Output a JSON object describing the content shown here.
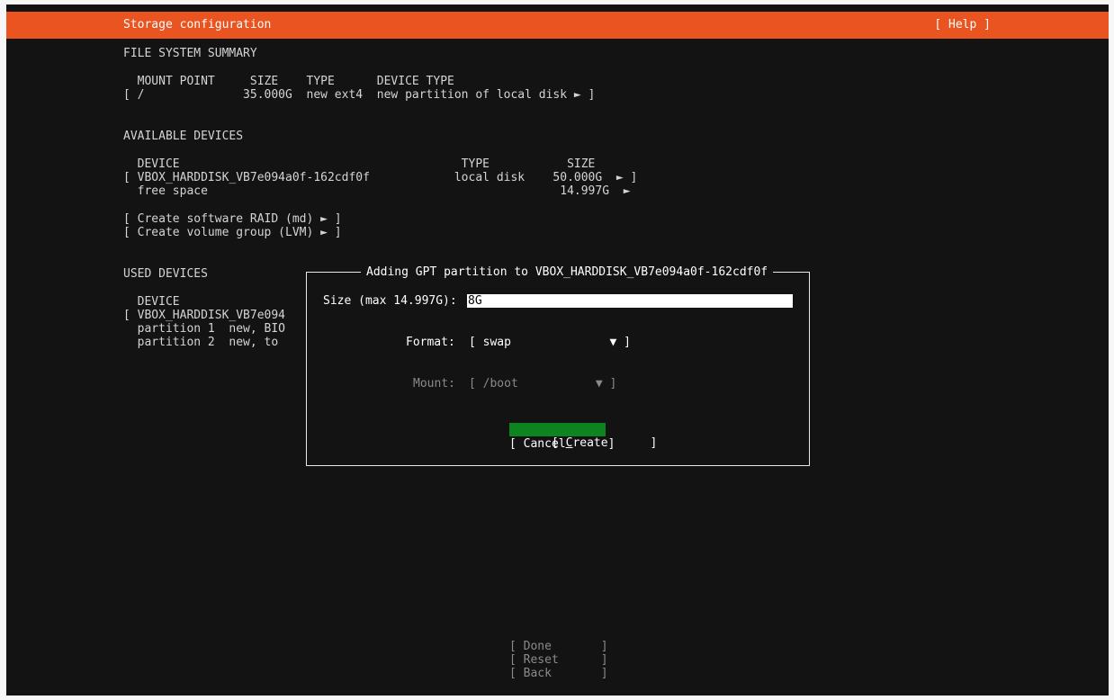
{
  "header": {
    "title": "Storage configuration",
    "help": "[ Help ]"
  },
  "fs_summary": {
    "heading": "FILE SYSTEM SUMMARY",
    "columns": "  MOUNT POINT     SIZE    TYPE      DEVICE TYPE",
    "rows": [
      "[ /              35.000G  new ext4  new partition of local disk ► ]"
    ]
  },
  "available": {
    "heading": "AVAILABLE DEVICES",
    "columns": "  DEVICE                                        TYPE           SIZE",
    "device_row": "[ VBOX_HARDDISK_VB7e094a0f-162cdf0f            local disk    50.000G  ► ]",
    "free_row": "  free space                                                  14.997G  ►",
    "raid": "[ Create software RAID (md) ► ]",
    "lvm": "[ Create volume group (LVM) ► ]"
  },
  "used": {
    "heading": "USED DEVICES",
    "columns": "  DEVICE",
    "rows": [
      "[ VBOX_HARDDISK_VB7e094",
      "  partition 1  new, BIO",
      "  partition 2  new, to"
    ]
  },
  "dialog": {
    "title": "Adding GPT partition to VBOX_HARDDISK_VB7e094a0f-162cdf0f",
    "size_label": "Size (max 14.997G):",
    "size_value": "8G",
    "format_label": "Format:",
    "format_value": "[ swap              ▼ ]",
    "mount_label": "Mount:",
    "mount_value": "[ /boot           ▼ ]",
    "create_prefix": "[ ",
    "create_hotkey": "C",
    "create_rest": "reate      ]",
    "cancel": "[ Cancel      ]"
  },
  "footer": {
    "done": "[ Done       ]",
    "reset": "[ Reset      ]",
    "back": "[ Back       ]"
  },
  "colors": {
    "accent": "#e95420",
    "background": "#131313",
    "selected_button": "#0e8420"
  }
}
